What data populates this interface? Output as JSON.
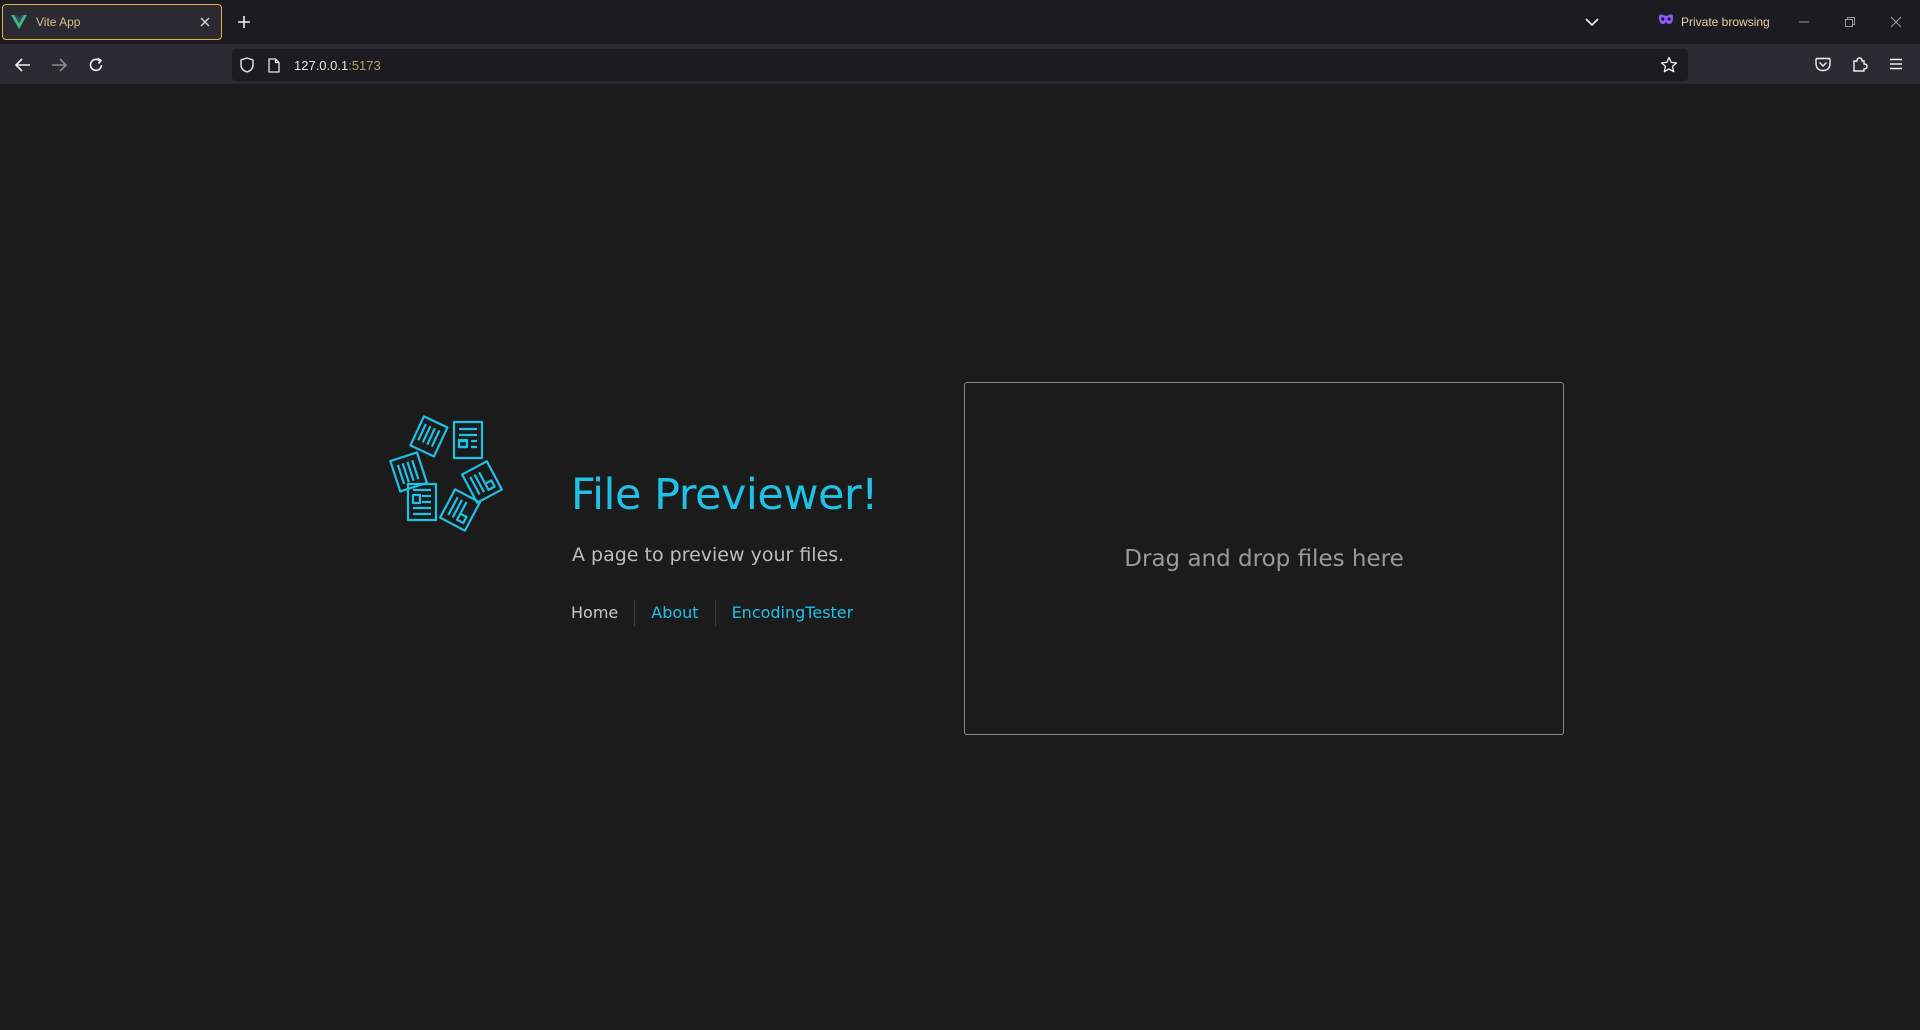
{
  "browser": {
    "tab": {
      "title": "Vite App"
    },
    "private_label": "Private browsing",
    "url": {
      "host": "127.0.0.1",
      "port": ":5173"
    },
    "icons": [
      "vue-favicon-icon",
      "close-tab-icon",
      "plus-icon",
      "chevron-down-icon",
      "private-mask-icon",
      "minimize-icon",
      "restore-icon",
      "close-window-icon",
      "back-arrow-icon",
      "forward-arrow-icon",
      "reload-icon",
      "shield-icon",
      "page-icon",
      "star-icon",
      "pocket-icon",
      "extensions-icon",
      "hamburger-menu-icon"
    ]
  },
  "app": {
    "title": "File Previewer!",
    "subtitle": "A page to preview your files.",
    "nav": [
      {
        "label": "Home"
      },
      {
        "label": "About"
      },
      {
        "label": "EncodingTester"
      }
    ],
    "dropzone_text": "Drag and drop files here",
    "accent_color": "#1fc1e6"
  }
}
